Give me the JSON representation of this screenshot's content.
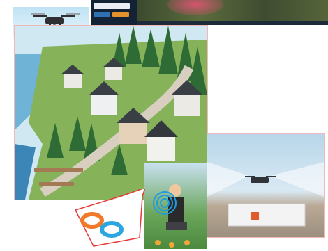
{
  "dashboard": {
    "search_value": "",
    "accent_blue": "#2f6fb3",
    "accent_orange": "#e2912b"
  },
  "colors": {
    "sky": "#cfe8f2",
    "water": "#3c86b7",
    "trees": "#2f6b35",
    "wristband_orange": "#f07a2a",
    "wristband_blue": "#2aa6e0",
    "inset_border": "#e53935",
    "signal_ring": "#1f9be0"
  },
  "icons": [
    "drone-icon",
    "wristband-icon",
    "signal-waves-icon"
  ]
}
